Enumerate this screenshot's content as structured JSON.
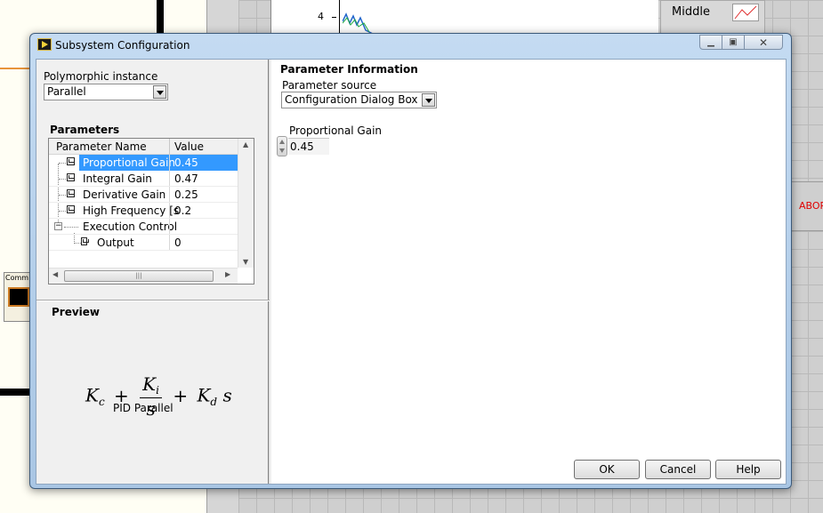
{
  "background": {
    "chart_tick": "4",
    "legend_label": "Middle",
    "abort_label": "ABOR",
    "node_label": "Comm"
  },
  "dialog": {
    "title": "Subsystem Configuration",
    "polymorphic_label": "Polymorphic instance",
    "polymorphic_value": "Parallel",
    "parameters_heading": "Parameters",
    "tree": {
      "col_name": "Parameter Name",
      "col_value": "Value",
      "rows": [
        {
          "name": "Proportional Gain",
          "value": "0.45"
        },
        {
          "name": "Integral Gain",
          "value": "0.47"
        },
        {
          "name": "Derivative Gain",
          "value": "0.25"
        },
        {
          "name": "High Frequency [s",
          "value": "0.2"
        },
        {
          "name": "Execution Control",
          "value": ""
        },
        {
          "name": "Output",
          "value": "0"
        }
      ]
    },
    "preview_heading": "Preview",
    "formula": {
      "kc": "K",
      "kc_sub": "c",
      "ki": "K",
      "ki_sub": "i",
      "s": "s",
      "kd": "K",
      "kd_sub": "d",
      "s2": "s"
    },
    "preview_caption": "PID Parallel",
    "param_info_heading": "Parameter Information",
    "param_source_label": "Parameter source",
    "param_source_value": "Configuration Dialog Box",
    "numeric_label": "Proportional Gain",
    "numeric_value": "0.45",
    "ok_label": "OK",
    "cancel_label": "Cancel",
    "help_label": "Help"
  }
}
